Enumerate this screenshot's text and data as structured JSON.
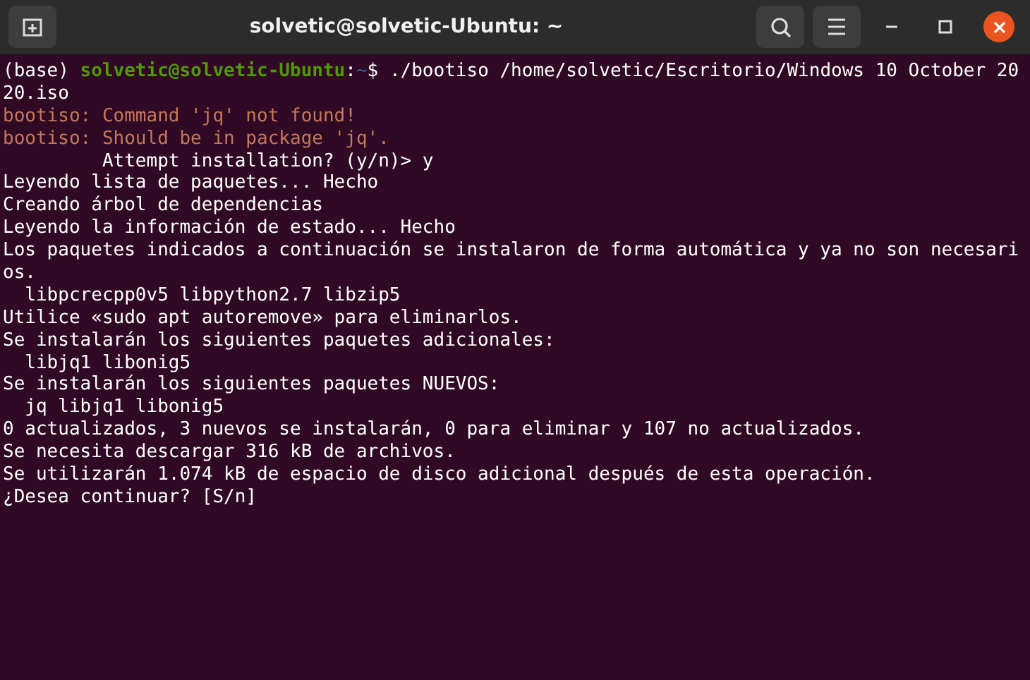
{
  "window": {
    "title": "solvetic@solvetic-Ubuntu: ~"
  },
  "terminal": {
    "lines": [
      [
        {
          "kind": "plain",
          "text": "(base) "
        },
        {
          "kind": "user",
          "text": "solvetic@solvetic-Ubuntu"
        },
        {
          "kind": "plain",
          "text": ":"
        },
        {
          "kind": "path",
          "text": "~"
        },
        {
          "kind": "plain",
          "text": "$ ./bootiso /home/solvetic/Escritorio/Windows 10 October 20"
        }
      ],
      [
        {
          "kind": "plain",
          "text": "20.iso"
        }
      ],
      [
        {
          "kind": "warn",
          "text": "bootiso: Command 'jq' not found!"
        }
      ],
      [
        {
          "kind": "warn",
          "text": "bootiso: Should be in package 'jq'."
        }
      ],
      [
        {
          "kind": "plain",
          "text": "         Attempt installation? (y/n)> y"
        }
      ],
      [
        {
          "kind": "plain",
          "text": "Leyendo lista de paquetes... Hecho"
        }
      ],
      [
        {
          "kind": "plain",
          "text": "Creando árbol de dependencias"
        }
      ],
      [
        {
          "kind": "plain",
          "text": "Leyendo la información de estado... Hecho"
        }
      ],
      [
        {
          "kind": "plain",
          "text": "Los paquetes indicados a continuación se instalaron de forma automática y ya no son necesari"
        }
      ],
      [
        {
          "kind": "plain",
          "text": "os."
        }
      ],
      [
        {
          "kind": "plain",
          "text": "  libpcrecpp0v5 libpython2.7 libzip5"
        }
      ],
      [
        {
          "kind": "plain",
          "text": "Utilice «sudo apt autoremove» para eliminarlos."
        }
      ],
      [
        {
          "kind": "plain",
          "text": "Se instalarán los siguientes paquetes adicionales:"
        }
      ],
      [
        {
          "kind": "plain",
          "text": "  libjq1 libonig5"
        }
      ],
      [
        {
          "kind": "plain",
          "text": "Se instalarán los siguientes paquetes NUEVOS:"
        }
      ],
      [
        {
          "kind": "plain",
          "text": "  jq libjq1 libonig5"
        }
      ],
      [
        {
          "kind": "plain",
          "text": "0 actualizados, 3 nuevos se instalarán, 0 para eliminar y 107 no actualizados."
        }
      ],
      [
        {
          "kind": "plain",
          "text": "Se necesita descargar 316 kB de archivos."
        }
      ],
      [
        {
          "kind": "plain",
          "text": "Se utilizarán 1.074 kB de espacio de disco adicional después de esta operación."
        }
      ],
      [
        {
          "kind": "plain",
          "text": "¿Desea continuar? [S/n]"
        }
      ]
    ]
  }
}
